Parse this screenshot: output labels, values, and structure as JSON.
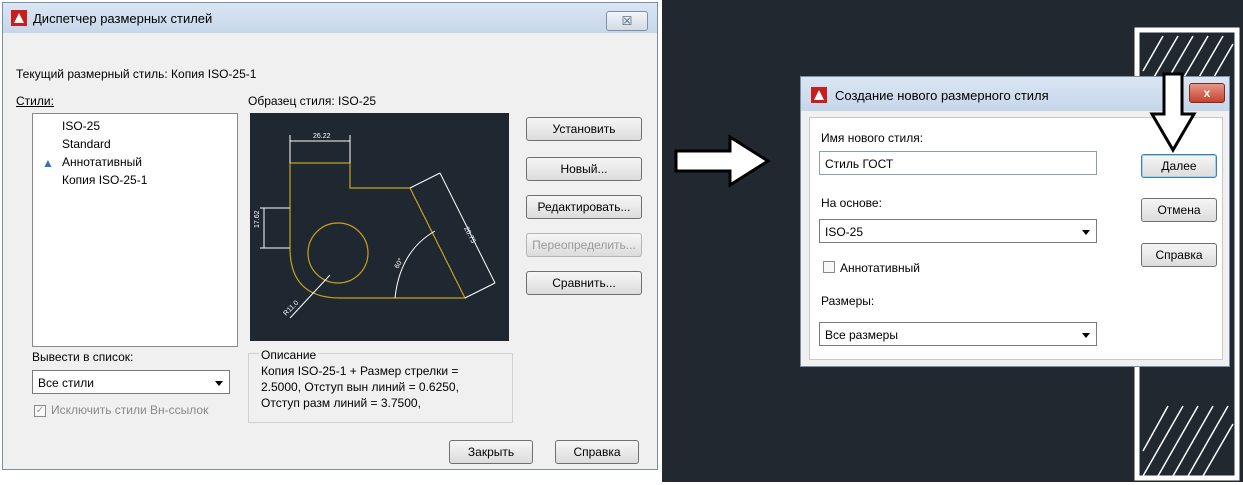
{
  "dim_manager": {
    "title": "Диспетчер размерных стилей",
    "close_glyph": "☒",
    "current_style_text": "Текущий размерный стиль: Копия ISO-25-1",
    "styles_label": "Стили:",
    "styles": [
      "ISO-25",
      "Standard",
      "Аннотативный",
      "Копия ISO-25-1"
    ],
    "preview_label": "Образец стиля: ISO-25",
    "list_label": "Вывести в список:",
    "list_value": "Все стили",
    "exclude_xref_label": "Исключить стили Вн-ссылок",
    "buttons": {
      "set": "Установить",
      "new": "Новый...",
      "edit": "Редактировать...",
      "override": "Переопределить...",
      "compare": "Сравнить...",
      "close": "Закрыть",
      "help": "Справка"
    },
    "description": {
      "title": "Описание",
      "lines": [
        "Копия ISO-25-1 + Размер стрелки =",
        "2.5000, Отступ вын линий = 0.6250,",
        "Отступ разм линий = 3.7500,"
      ]
    },
    "preview_dims": [
      "26.22",
      "17.62",
      "20.75",
      "R11.0",
      "60°"
    ]
  },
  "new_style": {
    "title": "Создание нового размерного стиля",
    "name_label": "Имя нового стиля:",
    "name_value": "Стиль ГОСТ",
    "based_on_label": "На основе:",
    "based_on_value": "ISO-25",
    "annotative_label": "Аннотативный",
    "sizes_label": "Размеры:",
    "sizes_value": "Все размеры",
    "buttons": {
      "next": "Далее",
      "cancel": "Отмена",
      "help": "Справка"
    },
    "close_glyph": "x"
  },
  "colors": {
    "accent_red": "#c81e1e",
    "preview_bg": "#1f2730",
    "dim_line": "#ffffff",
    "object_line": "#c8a020"
  }
}
